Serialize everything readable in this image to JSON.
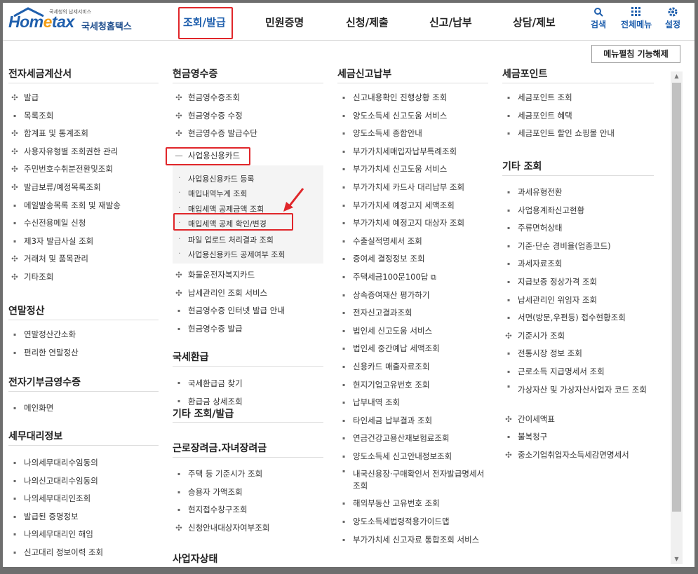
{
  "logo": {
    "sub": "국세청의 납세서비스",
    "brand_a": "Hom",
    "brand_e": "e",
    "brand_b": "tax",
    "kor": "국세청홈택스"
  },
  "gnb": [
    "조회/발급",
    "민원증명",
    "신청/제출",
    "신고/납부",
    "상담/제보"
  ],
  "util": {
    "search": "검색",
    "allmenu": "전체메뉴",
    "settings": "설정"
  },
  "menu_toggle": "메뉴펼침 기능해제",
  "col1": {
    "s1_title": "전자세금계산서",
    "s1": [
      "발급",
      "목록조회",
      "합계표 및 통계조회",
      "사용자유형별 조회권한 관리",
      "주민번호수취분전환및조회",
      "발급보류/예정목록조회",
      "메일발송목록 조회 및 재발송",
      "수신전용메일 신청",
      "제3자 발급사실 조회",
      "거래처 및 품목관리",
      "기타조회"
    ],
    "s1_marks": [
      "+",
      "·",
      "+",
      "+",
      "+",
      "+",
      "·",
      "·",
      "·",
      "+",
      "+"
    ],
    "s2_title": "연말정산",
    "s2": [
      "연말정산간소화",
      "편리한 연말정산"
    ],
    "s3_title": "전자기부금영수증",
    "s3": [
      "메인화면"
    ],
    "s4_title": "세무대리정보",
    "s4": [
      "나의세무대리수임동의",
      "나의신고대리수임동의",
      "나의세무대리인조회",
      "발급된 증명정보",
      "나의세무대리인 해임",
      "신고대리 정보이력 조회"
    ]
  },
  "col2": {
    "s1_title": "현금영수증",
    "s1a": [
      "현금영수증조회",
      "현금영수증 수정",
      "현금영수증 발급수단"
    ],
    "expanded": "사업용신용카드",
    "sub": [
      "사업용신용카드 등록",
      "매입내역누계 조회",
      "매입세액 공제금액 조회",
      "매입세액 공제 확인/변경",
      "파일 업로드 처리결과 조회",
      "사업용신용카드 공제여부 조회"
    ],
    "s1b": [
      "화물운전자복지카드",
      "납세관리인 조회 서비스",
      "현금영수증 인터넷 발급 안내",
      "현금영수증 발급"
    ],
    "s1b_marks": [
      "+",
      "+",
      "·",
      "·"
    ],
    "s2_title": "국세환급",
    "s2": [
      "국세환급금 찾기",
      "환급금 상세조회"
    ],
    "s3_title": "기타 조회/발급",
    "s4_title": "근로장려금.자녀장려금",
    "s4": [
      "주택 등 기준시가 조회",
      "승용자 가액조회",
      "현지접수창구조회",
      "신청안내대상자여부조회"
    ],
    "s4_marks": [
      "·",
      "·",
      "·",
      "+"
    ],
    "s5_title": "사업자상태"
  },
  "col3": {
    "s1_title": "세금신고납부",
    "s1": [
      "신고내용확인 진행상황 조회",
      "양도소득세 신고도움 서비스",
      "양도소득세 종합안내",
      "부가가치세매입자납부특례조회",
      "부가가치세 신고도움 서비스",
      "부가가치세 카드사 대리납부 조회",
      "부가가치세 예정고지 세액조회",
      "부가가치세 예정고지 대상자 조회",
      "수출실적명세서 조회",
      "증여세 결정정보 조회",
      "주택세금100문100답",
      "상속증여재산 평가하기",
      "전자신고결과조회",
      "법인세 신고도움 서비스",
      "법인세 중간예납 세액조회",
      "신용카드 매출자료조회",
      "현지기업고유번호 조회",
      "납부내역 조회",
      "타인세금 납부결과 조회",
      "연금건강고용산재보험료조회",
      "양도소득세 신고안내정보조회",
      "내국신용장·구매확인서 전자발급명세서 조회",
      "해외부동산 고유번호 조회",
      "양도소득세법령적용가이드맵",
      "부가가치세 신고자료 통합조회 서비스"
    ]
  },
  "col4": {
    "s1_title": "세금포인트",
    "s1": [
      "세금포인트 조회",
      "세금포인트 혜택",
      "세금포인트 할인 쇼핑몰 안내"
    ],
    "s2_title": "기타 조회",
    "s2": [
      "과세유형전환",
      "사업용계좌신고현황",
      "주류면허상태",
      "기준·단순 경비율(업종코드)",
      "과세자료조회",
      "지급보증 정상가격 조회",
      "납세관리인 위임자 조회",
      "서면(방문,우편등) 접수현황조회",
      "기준시가 조회",
      "전통시장 정보 조회",
      "근로소득 지급명세서 조회",
      "가상자산 및 가상자산사업자 코드 조회",
      "간이세액표",
      "불복청구",
      "중소기업취업자소득세감면명세서"
    ],
    "s2_marks": [
      "·",
      "·",
      "·",
      "·",
      "·",
      "·",
      "·",
      "·",
      "+",
      "·",
      "·",
      "·",
      "+",
      "·",
      "+"
    ]
  }
}
